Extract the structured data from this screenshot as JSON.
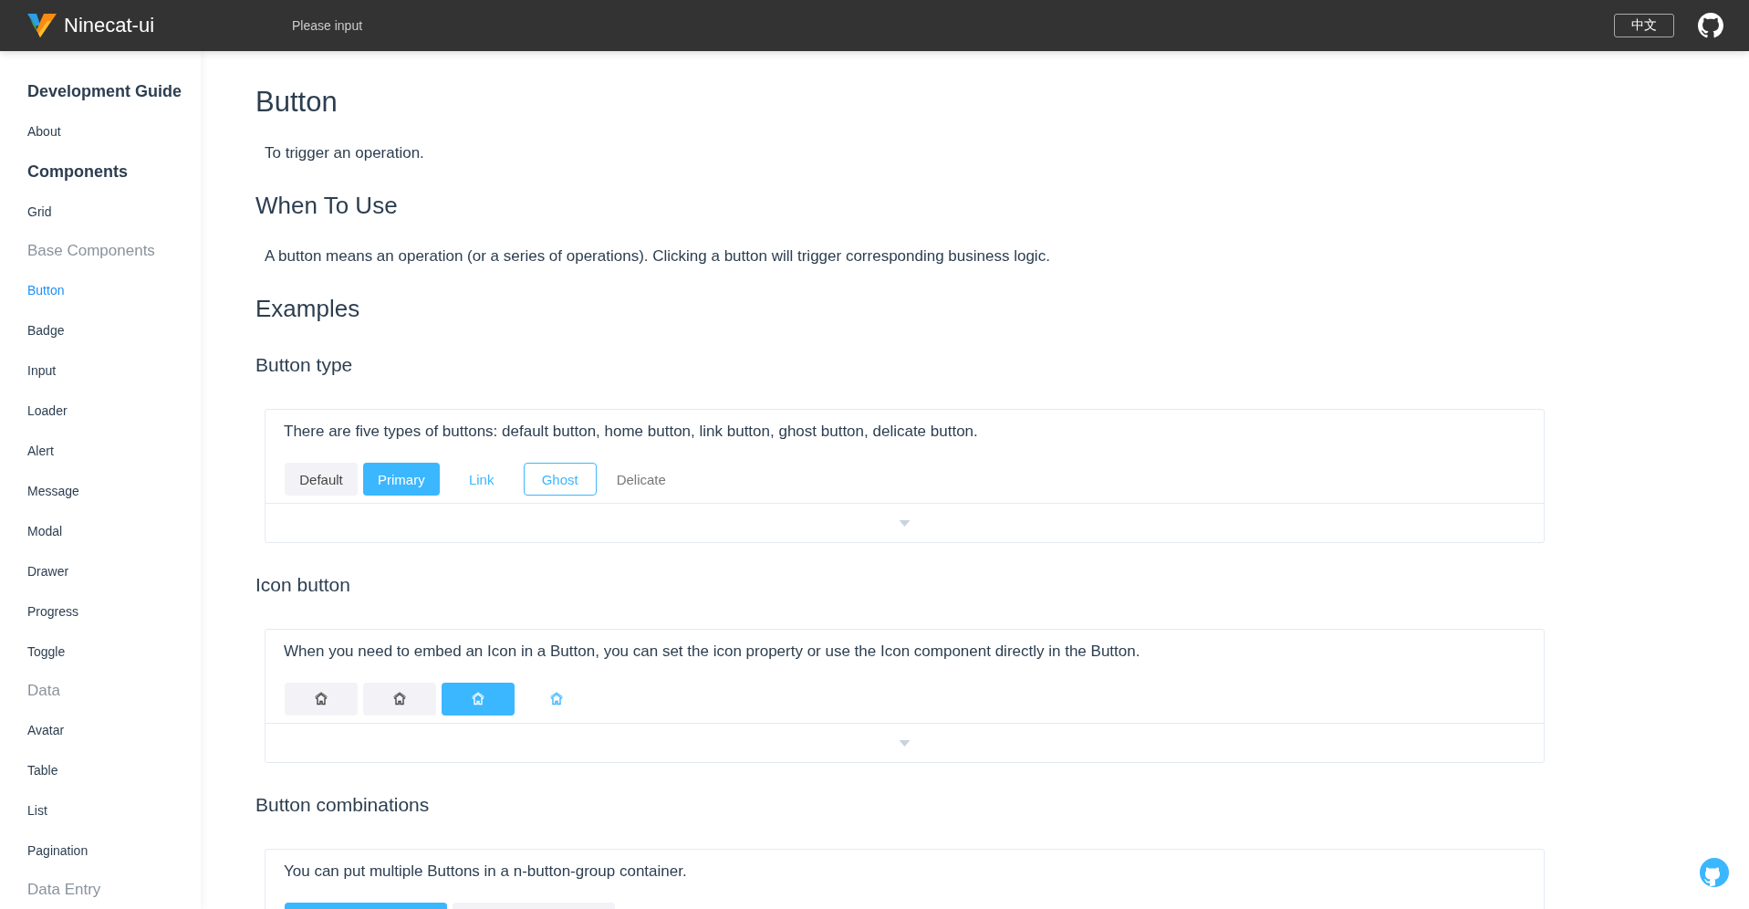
{
  "header": {
    "brand": "Ninecat-ui",
    "search": {
      "placeholder": "Please input"
    },
    "language": "中文"
  },
  "sidebar": {
    "items": [
      {
        "kind": "heading",
        "label": "Development Guide"
      },
      {
        "kind": "link",
        "label": "About",
        "selected": false
      },
      {
        "kind": "heading",
        "label": "Components"
      },
      {
        "kind": "link",
        "label": "Grid",
        "selected": false
      },
      {
        "kind": "category",
        "label": "Base Components"
      },
      {
        "kind": "link",
        "label": "Button",
        "selected": true
      },
      {
        "kind": "link",
        "label": "Badge",
        "selected": false
      },
      {
        "kind": "link",
        "label": "Input",
        "selected": false
      },
      {
        "kind": "link",
        "label": "Loader",
        "selected": false
      },
      {
        "kind": "link",
        "label": "Alert",
        "selected": false
      },
      {
        "kind": "link",
        "label": "Message",
        "selected": false
      },
      {
        "kind": "link",
        "label": "Modal",
        "selected": false
      },
      {
        "kind": "link",
        "label": "Drawer",
        "selected": false
      },
      {
        "kind": "link",
        "label": "Progress",
        "selected": false
      },
      {
        "kind": "link",
        "label": "Toggle",
        "selected": false
      },
      {
        "kind": "category",
        "label": "Data"
      },
      {
        "kind": "link",
        "label": "Avatar",
        "selected": false
      },
      {
        "kind": "link",
        "label": "Table",
        "selected": false
      },
      {
        "kind": "link",
        "label": "List",
        "selected": false
      },
      {
        "kind": "link",
        "label": "Pagination",
        "selected": false
      },
      {
        "kind": "category",
        "label": "Data Entry"
      }
    ]
  },
  "content": {
    "title": "Button",
    "intro": "To trigger an operation.",
    "when_heading": "When To Use",
    "when_text": "A button means an operation (or a series of operations). Clicking a button will trigger corresponding business logic.",
    "examples_heading": "Examples",
    "examples": [
      {
        "kind": "text",
        "title": "Button type",
        "description": "There are five types of buttons: default button, home button, link button, ghost button, delicate button.",
        "buttons": [
          {
            "kind": "default",
            "label": "Default"
          },
          {
            "kind": "primary",
            "label": "Primary"
          },
          {
            "kind": "link",
            "label": "Link"
          },
          {
            "kind": "ghost",
            "label": "Ghost"
          },
          {
            "kind": "delicate",
            "label": "Delicate"
          }
        ]
      },
      {
        "kind": "icon",
        "title": "Icon button",
        "description": "When you need to embed an Icon in a Button, you can set the icon property or use the Icon component directly in the Button.",
        "buttons": [
          {
            "kind": "default"
          },
          {
            "kind": "default"
          },
          {
            "kind": "primary"
          },
          {
            "kind": "link"
          }
        ]
      },
      {
        "kind": "group",
        "title": "Button combinations",
        "description": "You can put multiple Buttons in a n-button-group container.",
        "buttons": [
          {
            "kind": "primary"
          },
          {
            "kind": "default"
          }
        ]
      }
    ]
  }
}
